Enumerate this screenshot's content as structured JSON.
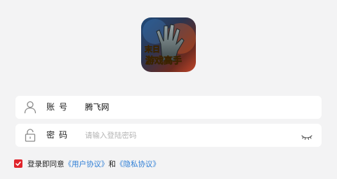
{
  "app": {
    "icon_name": "zombie-hand-game-logo",
    "icon_text": "末日游戏高手"
  },
  "account": {
    "label": "账号",
    "value": "腾飞网",
    "icon": "user-icon"
  },
  "password": {
    "label": "密码",
    "placeholder": "请输入登陆密码",
    "icon": "lock-icon",
    "toggle_icon": "eye-closed-icon"
  },
  "agreement": {
    "checked": true,
    "prefix": "登录即同意",
    "user_agreement": "《用户协议》",
    "conjunction": "和",
    "privacy_policy": "《隐私协议》"
  },
  "colors": {
    "background": "#f3f3f4",
    "accent_red": "#e0242b",
    "link_blue": "#2f7fd6",
    "placeholder_gray": "#b4b4b4"
  }
}
